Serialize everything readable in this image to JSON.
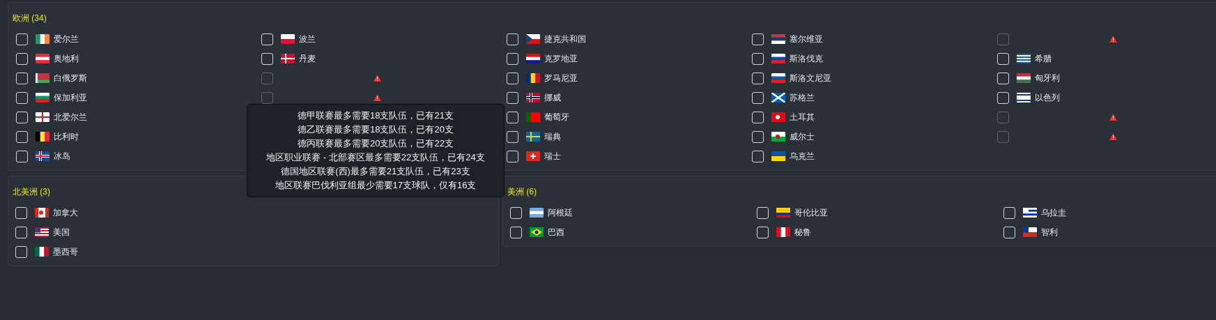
{
  "europe": {
    "title": "欧洲 (34)",
    "columns": [
      [
        {
          "label": "爱尔兰",
          "checked": false,
          "disabled": false
        },
        {
          "label": "奥地利",
          "checked": false,
          "disabled": false
        },
        {
          "label": "白俄罗斯",
          "checked": false,
          "disabled": false
        },
        {
          "label": "保加利亚",
          "checked": false,
          "disabled": false
        },
        {
          "label": "北爱尔兰",
          "checked": false,
          "disabled": false
        },
        {
          "label": "比利时",
          "checked": false,
          "disabled": false
        },
        {
          "label": "冰岛",
          "checked": false,
          "disabled": false
        }
      ],
      [
        {
          "label": "波兰",
          "checked": false,
          "disabled": false
        },
        {
          "label": "丹麦",
          "checked": false,
          "disabled": false
        },
        {
          "checked": false,
          "disabled": true
        },
        {
          "checked": false,
          "disabled": true
        }
      ],
      [
        {
          "label": "捷克共和国",
          "checked": false,
          "disabled": false
        },
        {
          "label": "克罗地亚",
          "checked": false,
          "disabled": false
        },
        {
          "label": "罗马尼亚",
          "checked": false,
          "disabled": false
        },
        {
          "label": "挪威",
          "checked": false,
          "disabled": false
        },
        {
          "label": "葡萄牙",
          "checked": false,
          "disabled": false
        },
        {
          "label": "瑞典",
          "checked": false,
          "disabled": false
        },
        {
          "label": "瑞士",
          "checked": false,
          "disabled": false
        }
      ],
      [
        {
          "label": "塞尔维亚",
          "checked": false,
          "disabled": false
        },
        {
          "label": "斯洛伐克",
          "checked": false,
          "disabled": false
        },
        {
          "label": "斯洛文尼亚",
          "checked": false,
          "disabled": false
        },
        {
          "label": "苏格兰",
          "checked": false,
          "disabled": false
        },
        {
          "label": "土耳其",
          "checked": false,
          "disabled": false
        },
        {
          "label": "威尔士",
          "checked": false,
          "disabled": false
        },
        {
          "label": "乌克兰",
          "checked": false,
          "disabled": false
        }
      ],
      [
        {
          "checked": false,
          "disabled": true
        },
        {
          "label": "希腊",
          "checked": false,
          "disabled": false
        },
        {
          "label": "匈牙利",
          "checked": false,
          "disabled": false
        },
        {
          "label": "以色列",
          "checked": false,
          "disabled": false
        },
        {
          "checked": false,
          "disabled": true
        },
        {
          "checked": false,
          "disabled": true
        }
      ]
    ]
  },
  "north_america": {
    "title": "北美洲 (3)",
    "columns": [
      [
        {
          "label": "加拿大",
          "checked": false,
          "disabled": false
        },
        {
          "label": "美国",
          "checked": false,
          "disabled": false
        },
        {
          "label": "墨西哥",
          "checked": false,
          "disabled": false
        }
      ]
    ]
  },
  "south_america": {
    "title": "美洲 (6)",
    "columns": [
      [
        {
          "label": "阿根廷",
          "checked": false,
          "disabled": false
        },
        {
          "label": "巴西",
          "checked": false,
          "disabled": false
        }
      ],
      [
        {
          "label": "哥伦比亚",
          "checked": false,
          "disabled": false
        },
        {
          "label": "秘鲁",
          "checked": false,
          "disabled": false
        }
      ],
      [
        {
          "label": "乌拉圭",
          "checked": false,
          "disabled": false
        },
        {
          "label": "智利",
          "checked": false,
          "disabled": false
        }
      ]
    ]
  },
  "tooltip": {
    "lines": [
      "德甲联赛最多需要18支队伍，已有21支",
      "德乙联赛最多需要18支队伍，已有20支",
      "德丙联赛最多需要20支队伍，已有22支",
      "地区职业联赛 - 北部赛区最多需要22支队伍，已有24支",
      "德国地区联赛(西)最多需要21支队伍，已有23支",
      "地区联赛巴伐利亚组最少需要17支球队，仅有16支"
    ]
  }
}
